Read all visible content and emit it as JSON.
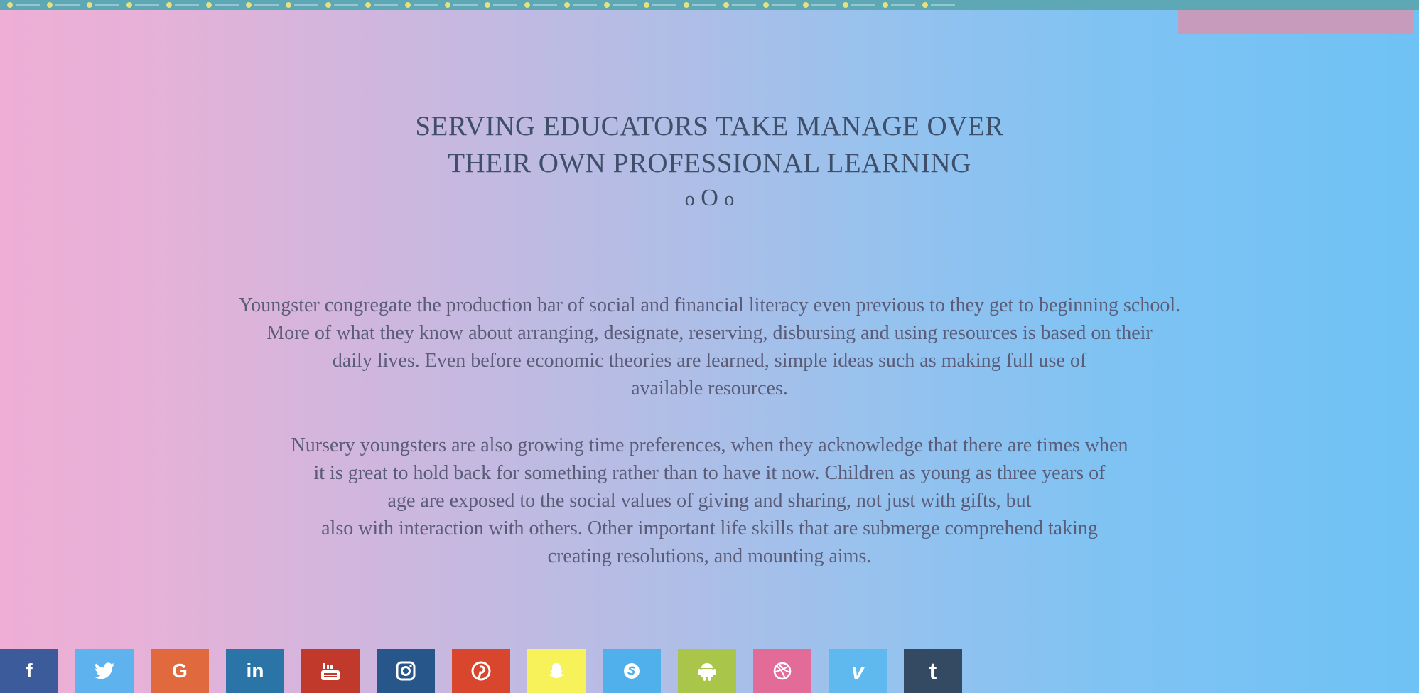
{
  "heading": {
    "line1": "SERVING EDUCATORS TAKE MANAGE OVER",
    "line2": "THEIR OWN PROFESSIONAL LEARNING",
    "ornament_left": "o",
    "ornament_center": "O",
    "ornament_right": "o"
  },
  "paragraph1": {
    "line1": "Youngster congregate the production bar of social and financial literacy even previous to they get to beginning school.",
    "line2": "More of what they know about arranging, designate, reserving, disbursing and using resources is based on their",
    "line3": "daily lives. Even before economic theories are learned, simple ideas such as making full use of",
    "line4": "available resources."
  },
  "paragraph2": {
    "line1": "Nursery youngsters are also growing time preferences, when they acknowledge that there are times when",
    "line2": "it is great to hold back for something rather than to have it now. Children as young as three years of",
    "line3": "age are exposed to the social values of giving and sharing, not just with gifts, but",
    "line4": "also with interaction with others. Other important life skills that are submerge comprehend taking",
    "line5": "creating resolutions, and mounting aims."
  },
  "social": [
    {
      "name": "facebook",
      "icon": "facebook-icon",
      "glyph": "f",
      "color": "#3b5b9a"
    },
    {
      "name": "twitter",
      "icon": "twitter-icon",
      "glyph": "",
      "color": "#5eb3ee"
    },
    {
      "name": "google",
      "icon": "google-icon",
      "glyph": "G",
      "color": "#e06a3e"
    },
    {
      "name": "linkedin",
      "icon": "linkedin-icon",
      "glyph": "in",
      "color": "#2a74a8"
    },
    {
      "name": "youtube",
      "icon": "youtube-icon",
      "glyph": "",
      "color": "#c0392b"
    },
    {
      "name": "instagram",
      "icon": "instagram-icon",
      "glyph": "",
      "color": "#26568a"
    },
    {
      "name": "pinterest",
      "icon": "pinterest-icon",
      "glyph": "",
      "color": "#d8462d"
    },
    {
      "name": "snapchat",
      "icon": "snapchat-icon",
      "glyph": "",
      "color": "#f7f15a"
    },
    {
      "name": "skype",
      "icon": "skype-icon",
      "glyph": "",
      "color": "#4fb0ec"
    },
    {
      "name": "android",
      "icon": "android-icon",
      "glyph": "",
      "color": "#a9c54a"
    },
    {
      "name": "dribbble",
      "icon": "dribbble-icon",
      "glyph": "",
      "color": "#e36b97"
    },
    {
      "name": "vimeo",
      "icon": "vimeo-icon",
      "glyph": "v",
      "color": "#5fb9ef"
    },
    {
      "name": "tumblr",
      "icon": "tumblr-icon",
      "glyph": "t",
      "color": "#344a63"
    }
  ]
}
